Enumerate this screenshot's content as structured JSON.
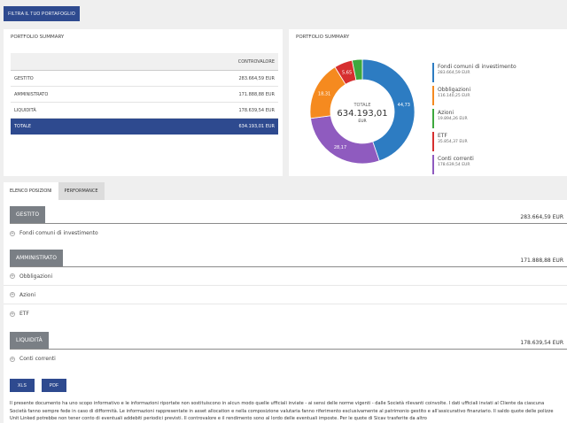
{
  "filter_button": "FILTRA IL TUO PORTAFOGLIO",
  "summary_left": {
    "title": "PORTFOLIO SUMMARY",
    "column_header": "CONTROVALORE",
    "rows": [
      {
        "label": "GESTITO",
        "value": "283.664,59 EUR"
      },
      {
        "label": "AMMINISTRATO",
        "value": "171.888,88 EUR"
      },
      {
        "label": "LIQUIDITÀ",
        "value": "178.639,54 EUR"
      }
    ],
    "total": {
      "label": "TOTALE",
      "value": "634.193,01 EUR"
    }
  },
  "summary_right": {
    "title": "PORTFOLIO SUMMARY",
    "center": {
      "label": "TOTALE",
      "value": "634.193,01",
      "unit": "EUR"
    }
  },
  "chart_data": {
    "type": "pie",
    "donut": true,
    "slices": [
      {
        "name": "Fondi comuni di investimento",
        "percent": 44.73,
        "label": "44,73",
        "amount": "283.664,59",
        "unit": "EUR",
        "color": "#2d7cc2"
      },
      {
        "name": "Conti correnti",
        "percent": 28.17,
        "label": "28,17",
        "amount": "178.639,54",
        "unit": "EUR",
        "color": "#8f5bbf"
      },
      {
        "name": "Obbligazioni",
        "percent": 18.31,
        "label": "18,31",
        "amount": "116.140,25",
        "unit": "EUR",
        "color": "#f58a1f"
      },
      {
        "name": "ETF",
        "percent": 5.65,
        "label": "5,65",
        "amount": "35.854,37",
        "unit": "EUR",
        "color": "#d62f2f"
      },
      {
        "name": "Azioni",
        "percent": 3.14,
        "label": "",
        "amount": "19.894,26",
        "unit": "EUR",
        "color": "#3da83d"
      }
    ],
    "legend_order": [
      0,
      2,
      4,
      3,
      1
    ],
    "legend_position": "right"
  },
  "tabs": [
    "ELENCO POSIZIONI",
    "PERFORMANCE"
  ],
  "sections": [
    {
      "label": "GESTITO",
      "amount": "283.664,59 EUR",
      "items": [
        "Fondi comuni di investimento"
      ]
    },
    {
      "label": "AMMINISTRATO",
      "amount": "171.888,88 EUR",
      "items": [
        "Obbligazioni",
        "Azioni",
        "ETF"
      ]
    },
    {
      "label": "LIQUIDITÀ",
      "amount": "178.639,54 EUR",
      "items": [
        "Conti correnti"
      ]
    }
  ],
  "export": {
    "xls": "XLS",
    "pdf": "PDF"
  },
  "disclaimer": "Il presente documento ha uno scopo informativo e le informazioni riportate non sostituiscono in alcun modo quelle ufficiali inviate - ai sensi delle norme vigenti - dalle Società rilevanti coinvolte. I dati ufficiali inviati al Cliente da ciascuna Società fanno sempre fede in caso di difformità. Le informazioni rappresentate in asset allocation e nella composizione valutaria fanno riferimento esclusivamente al patrimonio gestito e all'assicurativo finanziario. Il saldo quote delle polizze Unit Linked potrebbe non tener conto di eventuali addebiti periodici previsti. Il controvalore e il rendimento sono al lordo delle eventuali imposte. Per le quote di Sicav trasferite da altro"
}
